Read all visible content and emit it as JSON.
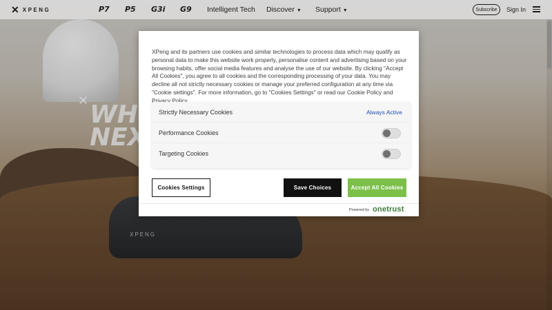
{
  "nav": {
    "logo_text": "XPENG",
    "models": [
      "P7",
      "P5",
      "G3i",
      "G9"
    ],
    "links": [
      {
        "label": "Intelligent Tech",
        "chevron": false
      },
      {
        "label": "Discover",
        "chevron": true
      },
      {
        "label": "Support",
        "chevron": true
      }
    ],
    "subscribe_label": "Subscribe",
    "signin_label": "Sign In"
  },
  "hero": {
    "headline_line1": "WH",
    "headline_line2": "NEX",
    "car_badge": "XPENG"
  },
  "cookie_dialog": {
    "description": "XPeng and its partners use cookies and similar technologies to process data which may qualify as personal data to make this website work properly, personalise content and advertising based on your browsing habits, offer social media features and analyse the use of our website. By clicking \"Accept All Cookies\", you agree to all cookies and the corresponding processing of your data. You may decline all not strictly necessary cookies or manage your preferred configuration at any time via \"Cookie settings\". For more information, go to \"Cookies Settings\" or read our Cookie Policy and Privacy Policy.",
    "preferences": [
      {
        "label": "Strictly Necessary Cookies",
        "status": "Always Active"
      },
      {
        "label": "Performance Cookies",
        "enabled": false
      },
      {
        "label": "Targeting Cookies",
        "enabled": false
      }
    ],
    "buttons": {
      "settings": "Cookies Settings",
      "save": "Save Choices",
      "accept": "Accept All Cookies"
    },
    "powered_by": "Powered by",
    "brand": "onetrust"
  },
  "colors": {
    "accept_button": "#7cc04a",
    "always_active": "#1f4fb5",
    "save_button": "#111111"
  }
}
